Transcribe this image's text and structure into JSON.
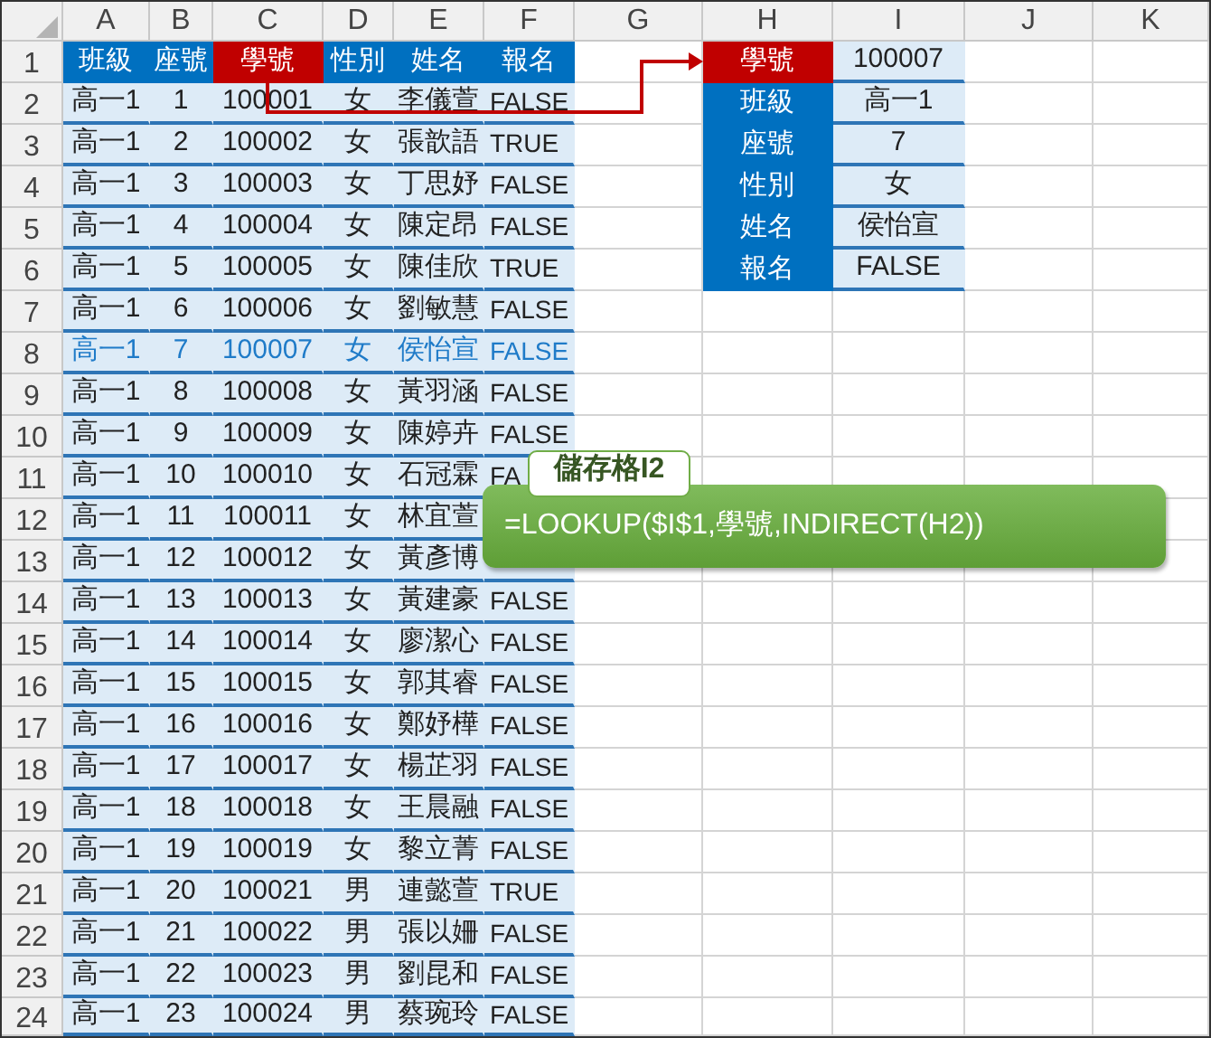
{
  "column_headers": [
    "A",
    "B",
    "C",
    "D",
    "E",
    "F",
    "G",
    "H",
    "I",
    "J",
    "K"
  ],
  "row_numbers": [
    "1",
    "2",
    "3",
    "4",
    "5",
    "6",
    "7",
    "8",
    "9",
    "10",
    "11",
    "12",
    "13",
    "14",
    "15",
    "16",
    "17",
    "18",
    "19",
    "20",
    "21",
    "22",
    "23",
    "24"
  ],
  "table": {
    "columns": [
      {
        "text": "班級",
        "highlighted": false
      },
      {
        "text": "座號",
        "highlighted": false
      },
      {
        "text": "學號",
        "highlighted": true
      },
      {
        "text": "性別",
        "highlighted": false
      },
      {
        "text": "姓名",
        "highlighted": false
      },
      {
        "text": "報名",
        "highlighted": false
      }
    ],
    "rows": [
      {
        "cells": [
          "高一1",
          "1",
          "100001",
          "女",
          "李儀萱",
          "FALSE"
        ],
        "highlighted": false
      },
      {
        "cells": [
          "高一1",
          "2",
          "100002",
          "女",
          "張歆語",
          "TRUE"
        ],
        "highlighted": false
      },
      {
        "cells": [
          "高一1",
          "3",
          "100003",
          "女",
          "丁思妤",
          "FALSE"
        ],
        "highlighted": false
      },
      {
        "cells": [
          "高一1",
          "4",
          "100004",
          "女",
          "陳定昂",
          "FALSE"
        ],
        "highlighted": false
      },
      {
        "cells": [
          "高一1",
          "5",
          "100005",
          "女",
          "陳佳欣",
          "TRUE"
        ],
        "highlighted": false
      },
      {
        "cells": [
          "高一1",
          "6",
          "100006",
          "女",
          "劉敏慧",
          "FALSE"
        ],
        "highlighted": false
      },
      {
        "cells": [
          "高一1",
          "7",
          "100007",
          "女",
          "侯怡宣",
          "FALSE"
        ],
        "highlighted": true
      },
      {
        "cells": [
          "高一1",
          "8",
          "100008",
          "女",
          "黃羽涵",
          "FALSE"
        ],
        "highlighted": false
      },
      {
        "cells": [
          "高一1",
          "9",
          "100009",
          "女",
          "陳婷卉",
          "FALSE"
        ],
        "highlighted": false
      },
      {
        "cells": [
          "高一1",
          "10",
          "100010",
          "女",
          "石冠霖",
          "FA"
        ],
        "highlighted": false
      },
      {
        "cells": [
          "高一1",
          "11",
          "100011",
          "女",
          "林宜萱"
        ],
        "highlighted": false
      },
      {
        "cells": [
          "高一1",
          "12",
          "100012",
          "女",
          "黃彥博"
        ],
        "highlighted": false
      },
      {
        "cells": [
          "高一1",
          "13",
          "100013",
          "女",
          "黃建豪",
          "FALSE"
        ],
        "highlighted": false
      },
      {
        "cells": [
          "高一1",
          "14",
          "100014",
          "女",
          "廖潔心",
          "FALSE"
        ],
        "highlighted": false
      },
      {
        "cells": [
          "高一1",
          "15",
          "100015",
          "女",
          "郭其睿",
          "FALSE"
        ],
        "highlighted": false
      },
      {
        "cells": [
          "高一1",
          "16",
          "100016",
          "女",
          "鄭妤樺",
          "FALSE"
        ],
        "highlighted": false
      },
      {
        "cells": [
          "高一1",
          "17",
          "100017",
          "女",
          "楊芷羽",
          "FALSE"
        ],
        "highlighted": false
      },
      {
        "cells": [
          "高一1",
          "18",
          "100018",
          "女",
          "王晨融",
          "FALSE"
        ],
        "highlighted": false
      },
      {
        "cells": [
          "高一1",
          "19",
          "100019",
          "女",
          "黎立菁",
          "FALSE"
        ],
        "highlighted": false
      },
      {
        "cells": [
          "高一1",
          "20",
          "100021",
          "男",
          "連懿萱",
          "TRUE"
        ],
        "highlighted": false
      },
      {
        "cells": [
          "高一1",
          "21",
          "100022",
          "男",
          "張以姍",
          "FALSE"
        ],
        "highlighted": false
      },
      {
        "cells": [
          "高一1",
          "22",
          "100023",
          "男",
          "劉昆和",
          "FALSE"
        ],
        "highlighted": false
      },
      {
        "cells": [
          "高一1",
          "23",
          "100024",
          "男",
          "蔡琬玲",
          "FALSE"
        ],
        "highlighted": false
      }
    ]
  },
  "lookup": {
    "rows": [
      {
        "label": "學號",
        "value": "100007",
        "highlighted": true
      },
      {
        "label": "班級",
        "value": "高一1",
        "highlighted": false
      },
      {
        "label": "座號",
        "value": "7",
        "highlighted": false
      },
      {
        "label": "性別",
        "value": "女",
        "highlighted": false
      },
      {
        "label": "姓名",
        "value": "侯怡宣",
        "highlighted": false
      },
      {
        "label": "報名",
        "value": "FALSE",
        "highlighted": false
      }
    ]
  },
  "callout": {
    "title": "儲存格I2",
    "formula": "=LOOKUP($I$1,學號,INDIRECT(H2))"
  }
}
